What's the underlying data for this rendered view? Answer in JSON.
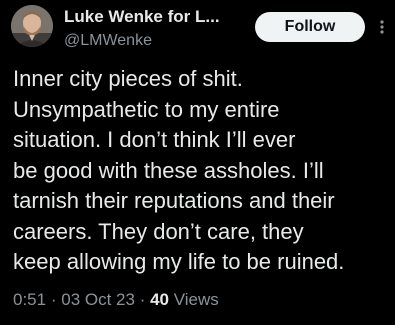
{
  "author": {
    "name": "Luke Wenke for L...",
    "handle": "@LMWenke"
  },
  "actions": {
    "follow_label": "Follow",
    "more_icon": "more-vertical-icon"
  },
  "tweet": {
    "lines": [
      "Inner city pieces of shit.",
      "Unsympathetic to my entire",
      "situation.  I don’t think I’ll ever",
      "be good with these assholes.  I’ll",
      "tarnish their reputations and their",
      "careers.  They don’t care, they",
      "keep allowing my life to be ruined."
    ],
    "time": "0:51",
    "separator": "·",
    "date": "03 Oct 23",
    "views_count": "40",
    "views_label": "Views"
  },
  "colors": {
    "background": "#000000",
    "text_primary": "#e7e9ea",
    "text_secondary": "#8b9298",
    "follow_bg": "#eff3f4",
    "follow_text": "#0f1419"
  }
}
